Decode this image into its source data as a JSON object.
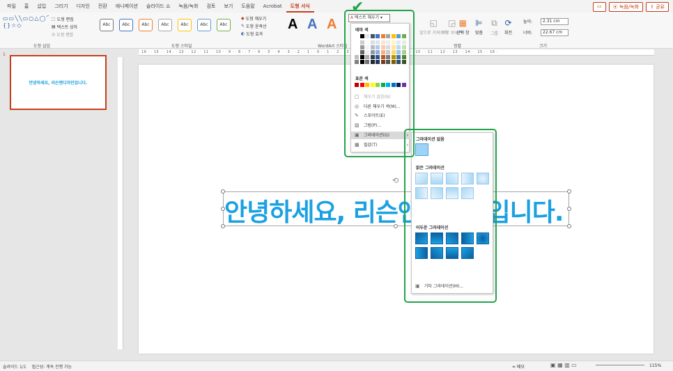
{
  "menu": {
    "items": [
      "파일",
      "홈",
      "삽입",
      "그리기",
      "디자인",
      "전환",
      "애니메이션",
      "슬라이드 쇼",
      "녹음/녹화",
      "검토",
      "보기",
      "도움말",
      "Acrobat",
      "도형 서식"
    ],
    "active": "도형 서식",
    "record_button": "⦿ 녹음/녹화",
    "share_button": "⇧ 공유"
  },
  "ribbon": {
    "insert_shapes_label": "도형 삽입",
    "edit_shape": "도형 편집",
    "text_box": "텍스트 상자",
    "merge_shapes": "도형 병합",
    "shape_styles_label": "도형 스타일",
    "style_sample": "Abc",
    "shape_fill": "도형 채우기",
    "shape_outline": "도형 윤곽선",
    "shape_effects": "도형 효과",
    "wordart_label": "WordArt 스타일",
    "wordart_letter": "A",
    "arrange_label": "정렬",
    "arrange_back": "뒤로 보내기",
    "arrange_forward": "앞으로 가져오기",
    "selection_pane": "선택 창",
    "align": "맞춤",
    "group": "그룹",
    "rotate": "회전",
    "size_label": "크기",
    "height_label": "높이:",
    "height_value": "2.31 cm",
    "width_label": "너비:",
    "width_value": "22.67 cm"
  },
  "text_fill_button": "텍스트 채우기",
  "dropdown": {
    "theme_colors": "테마 색",
    "standard_colors": "표준 색",
    "no_fill": "채우기 없음(N)",
    "more_colors": "다른 채우기 색(M)...",
    "eyedropper": "스포이트(E)",
    "picture": "그림(P)...",
    "gradient": "그라데이션(G)",
    "texture": "질감(T)"
  },
  "submenu": {
    "no_gradient": "그라데이션 없음",
    "light_gradients": "밝은 그라데이션",
    "dark_gradients": "어두운 그라데이션",
    "more_gradients": "기타 그라데이션(M)..."
  },
  "thumbnail": {
    "number": "1",
    "text": "안녕하세요, 리슨앤디자인입니다."
  },
  "slide": {
    "text": "안녕하세요, 리슨앤디자인입니다."
  },
  "ruler": {
    "ticks": "· 16 · · 15 · · 14 · · 13 · · 12 · · 11 · · 10 · · 9 · · 8 · · 7 · · 6 · · 5 · · 4 · · 3 · · 2 · · 1 · · 0 · · 1 · · 2 · · 3 · · 4 · · 5 · · 6 · · 7 · · 8 · · 9 · · 10 · · 11 · · 12 · · 13 · · 14 · · 15 · · 16 ·"
  },
  "status": {
    "slide_count": "슬라이드 1/1",
    "accessibility": "접근성: 계속 진행 가능",
    "notes": "≐ 메모",
    "zoom": "115%"
  },
  "colors": {
    "theme_row": [
      "#ffffff",
      "#000000",
      "#e7e6e6",
      "#44546a",
      "#4472c4",
      "#ed7d31",
      "#a5a5a5",
      "#ffc000",
      "#5b9bd5",
      "#70ad47"
    ],
    "standard_row": [
      "#c00000",
      "#ff0000",
      "#ffc000",
      "#ffff00",
      "#92d050",
      "#00b050",
      "#00b0f0",
      "#0070c0",
      "#002060",
      "#7030a0"
    ],
    "accent": "#1ba1e2",
    "highlight": "#22a34a"
  }
}
